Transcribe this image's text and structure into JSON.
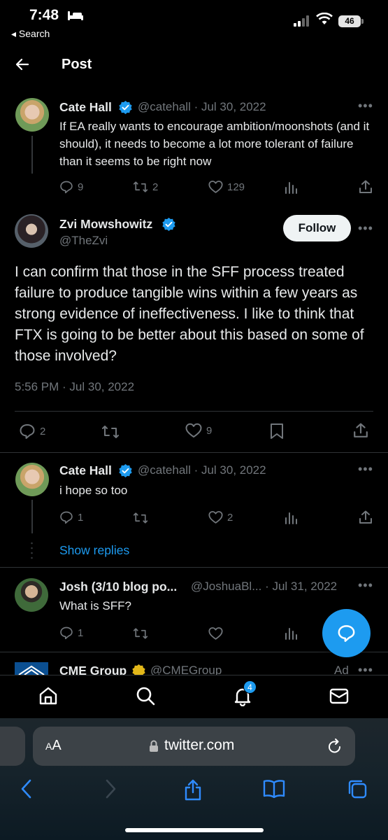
{
  "status_bar": {
    "time": "7:48",
    "back_app": "◂ Search",
    "battery": "46"
  },
  "header": {
    "title": "Post"
  },
  "tweet1": {
    "name": "Cate Hall",
    "handle_date": "@catehall · Jul 30, 2022",
    "text": "If EA really wants to encourage ambition/moonshots (and it should), it needs to become a lot more tolerant of failure than it seems to be right now",
    "replies": "9",
    "retweets": "2",
    "likes": "129"
  },
  "main_tweet": {
    "name": "Zvi Mowshowitz",
    "handle": "@TheZvi",
    "follow_label": "Follow",
    "text": "I can confirm that those in the SFF process treated failure to produce tangible wins within a few years as strong evidence of ineffectiveness. I like to think that FTX is going to be better about this based on some of those involved?",
    "timestamp": "5:56 PM · Jul 30, 2022",
    "replies": "2",
    "likes": "9"
  },
  "reply1": {
    "name": "Cate Hall",
    "handle_date": "@catehall · Jul 30, 2022",
    "text": "i hope so too",
    "replies": "1",
    "likes": "2",
    "show_replies": "Show replies"
  },
  "reply2": {
    "name": "Josh (3/10 blog po...",
    "handle_date": "@JoshuaBl... · Jul 31, 2022",
    "text": "What is SFF?",
    "replies": "1"
  },
  "ad": {
    "name": "CME Group",
    "handle": "@CMEGroup",
    "label": "Ad"
  },
  "nav": {
    "notifications_badge": "4"
  },
  "safari": {
    "aa": "AA",
    "url": "twitter.com"
  },
  "colors": {
    "accent": "#1d9bf0",
    "muted": "#71767b",
    "background": "#000000"
  }
}
